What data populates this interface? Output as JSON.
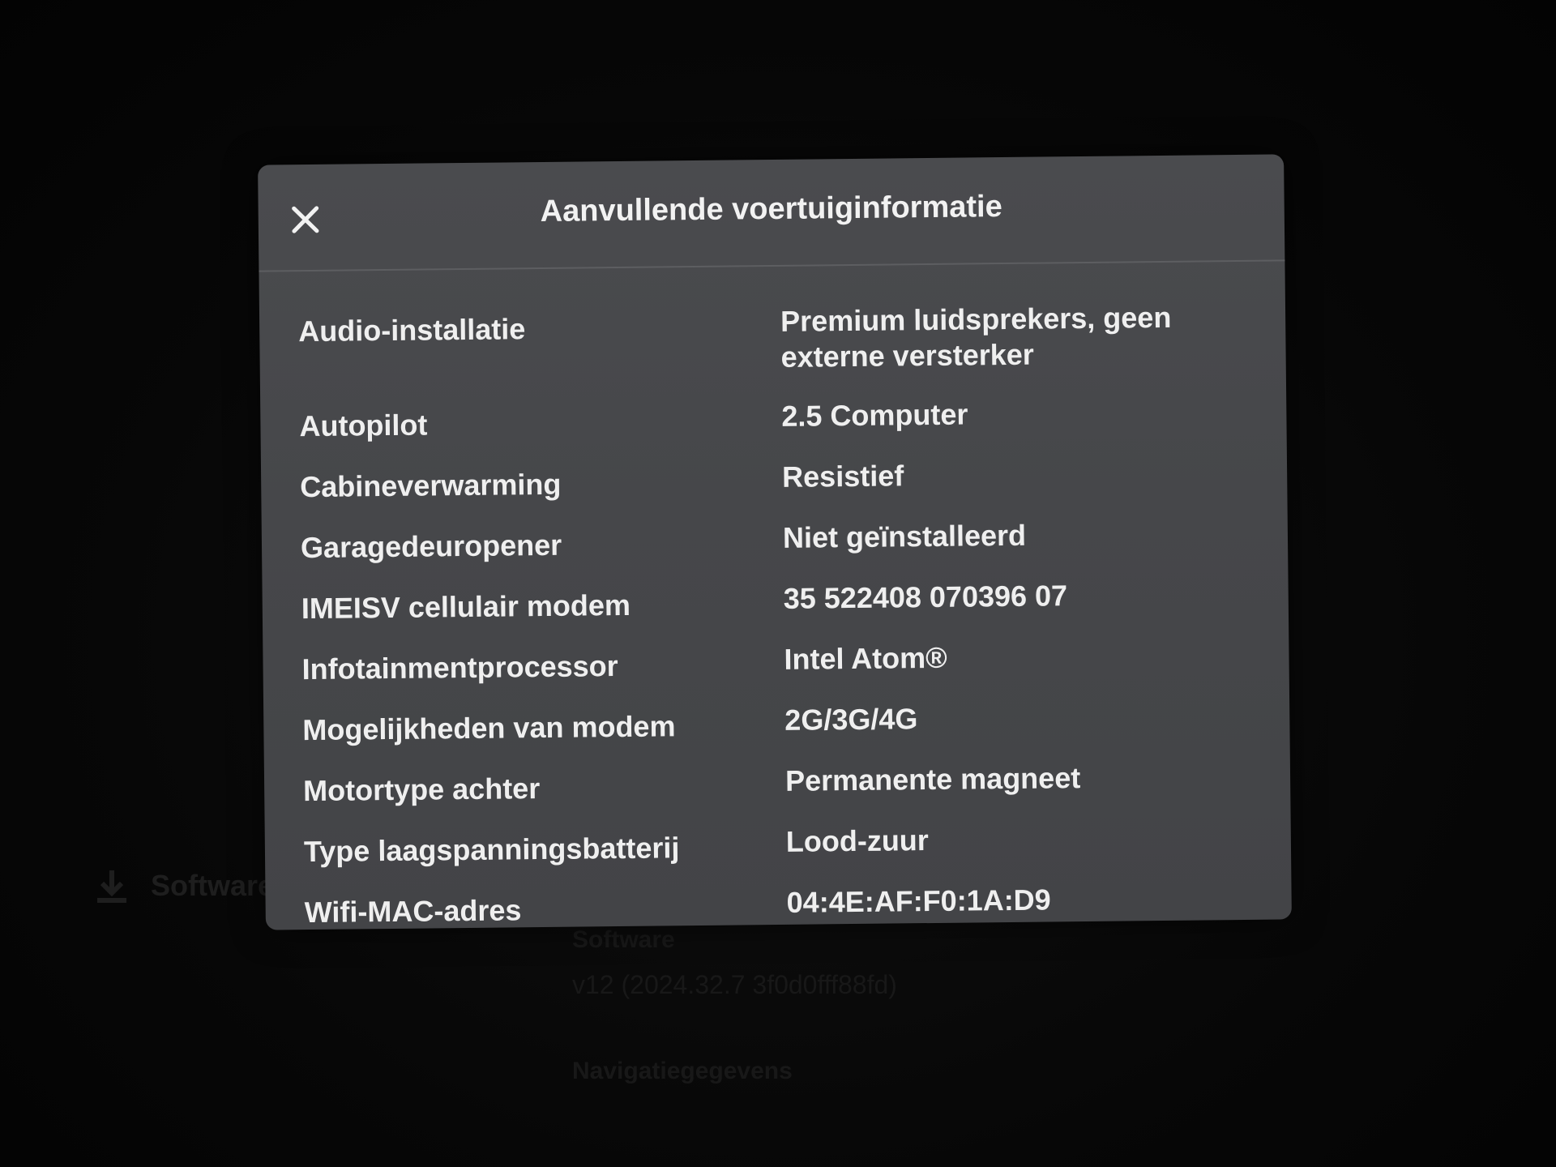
{
  "modal": {
    "title": "Aanvullende voertuiginformatie",
    "close_icon": "close-icon",
    "rows": [
      {
        "label": "Audio-installatie",
        "value": "Premium luidsprekers, geen externe versterker"
      },
      {
        "label": "Autopilot",
        "value": "2.5 Computer"
      },
      {
        "label": "Cabineverwarming",
        "value": "Resistief"
      },
      {
        "label": "Garagedeuropener",
        "value": "Niet geïnstalleerd"
      },
      {
        "label": "IMEISV cellulair modem",
        "value": "35 522408 070396 07"
      },
      {
        "label": "Infotainmentprocessor",
        "value": "Intel Atom®"
      },
      {
        "label": "Mogelijkheden van modem",
        "value": "2G/3G/4G"
      },
      {
        "label": "Motortype achter",
        "value": "Permanente magneet"
      },
      {
        "label": "Type laagspanningsbatterij",
        "value": "Lood-zuur"
      },
      {
        "label": "Wifi-MAC-adres",
        "value": "04:4E:AF:F0:1A:D9"
      }
    ]
  },
  "background": {
    "download_icon": "download-icon",
    "download_label": "Software",
    "software_heading": "Software",
    "software_version": "v12 (2024.32.7 3f0d0fff88fd)",
    "navigation_heading": "Navigatiegegevens"
  },
  "colors": {
    "modal_background": "#48494c",
    "text": "#efefef",
    "page_background": "#060606"
  }
}
